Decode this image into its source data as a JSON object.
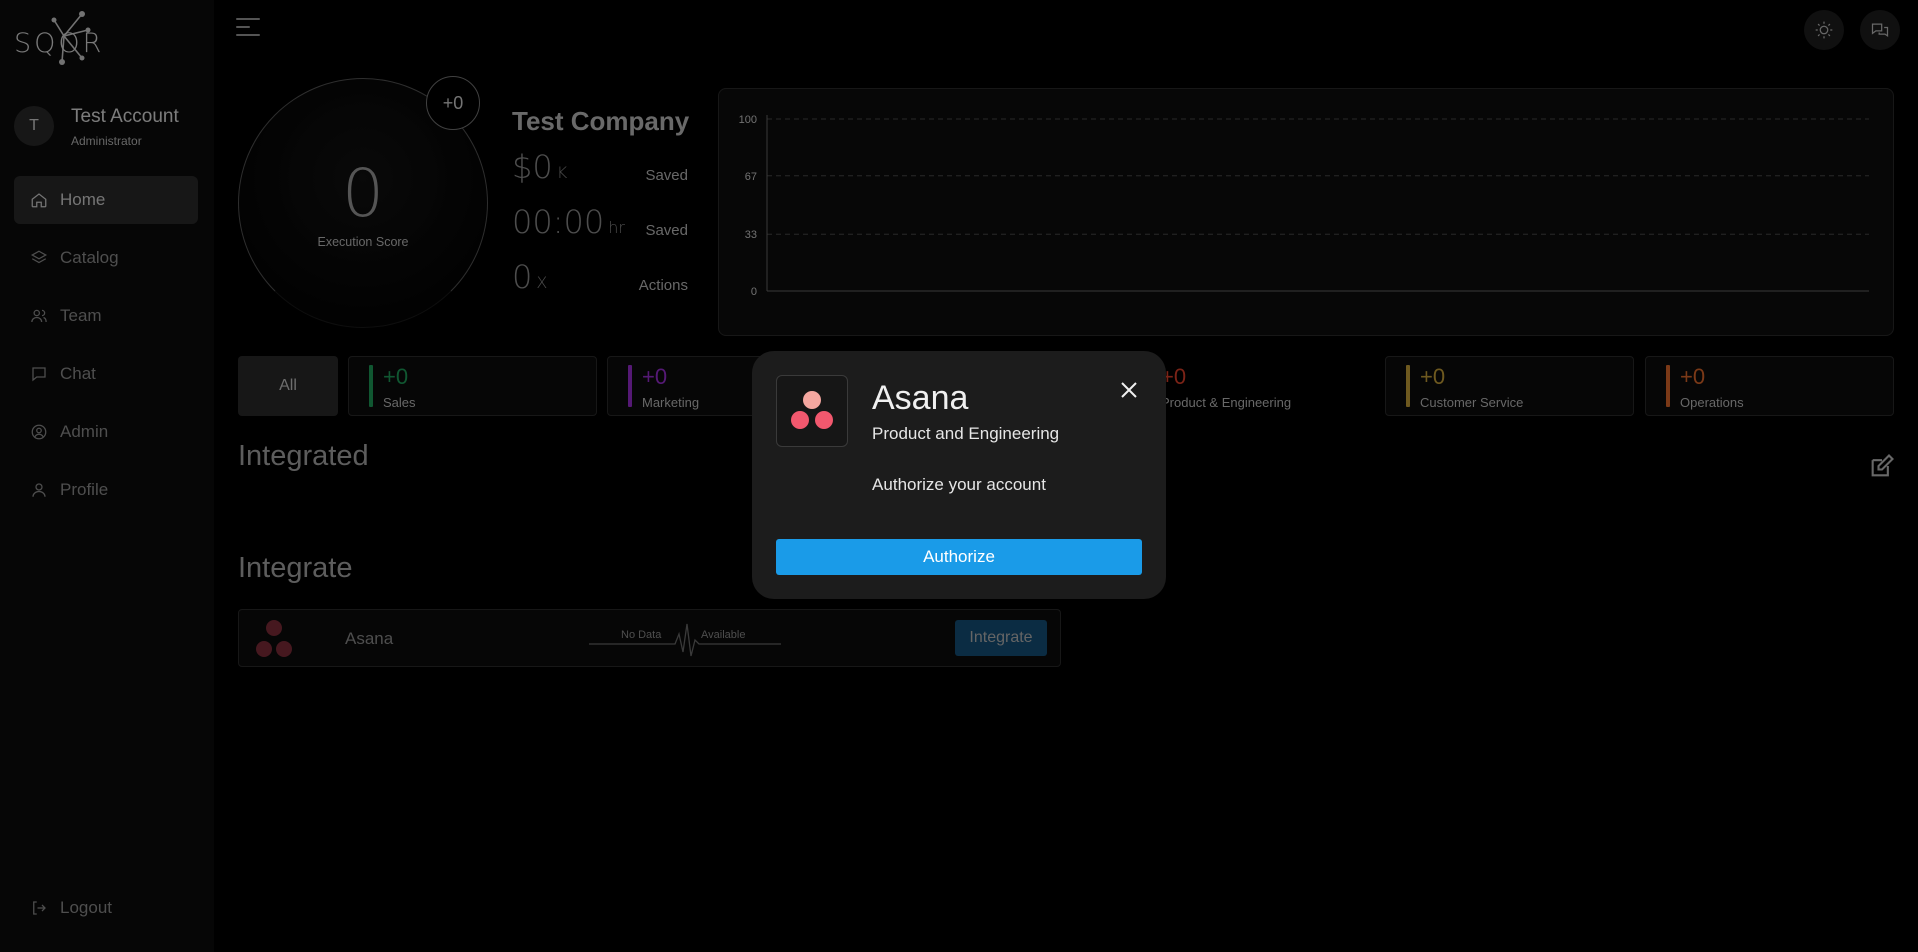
{
  "logo": {
    "text": "SQOR"
  },
  "user": {
    "initial": "T",
    "name": "Test Account",
    "role": "Administrator"
  },
  "nav": {
    "items": [
      {
        "label": "Home",
        "icon": "home-icon",
        "active": true
      },
      {
        "label": "Catalog",
        "icon": "layers-icon",
        "active": false
      },
      {
        "label": "Team",
        "icon": "users-icon",
        "active": false
      },
      {
        "label": "Chat",
        "icon": "chat-icon",
        "active": false
      },
      {
        "label": "Admin",
        "icon": "admin-icon",
        "active": false
      },
      {
        "label": "Profile",
        "icon": "profile-icon",
        "active": false
      }
    ],
    "logout": "Logout"
  },
  "score": {
    "value": "0",
    "label": "Execution Score",
    "delta": "+0"
  },
  "company": {
    "name": "Test Company",
    "metrics": [
      {
        "value": "$0",
        "unit": "K",
        "label": "Saved"
      },
      {
        "value": "00:00",
        "unit": "hr",
        "label": "Saved"
      },
      {
        "value": "0",
        "unit": "X",
        "label": "Actions"
      }
    ]
  },
  "chart_data": {
    "type": "line",
    "ylim": [
      0,
      100
    ],
    "yticks": [
      "100",
      "67",
      "33",
      "0"
    ],
    "grid": true,
    "series": []
  },
  "categories": {
    "all_label": "All",
    "items": [
      {
        "value": "+0",
        "name": "Sales",
        "color": "#1e9e5a"
      },
      {
        "value": "+0",
        "name": "Marketing",
        "color": "#9b2fd6"
      },
      {
        "value": "+0",
        "name": "Product & Engineering",
        "color": "#e0402a"
      },
      {
        "value": "+0",
        "name": "Customer Service",
        "color": "#c9a23a"
      },
      {
        "value": "+0",
        "name": "Operations",
        "color": "#e0682a"
      }
    ]
  },
  "sections": {
    "integrated": "Integrated",
    "integrate": "Integrate"
  },
  "integration": {
    "name": "Asana",
    "no_data": "No Data",
    "available": "Available",
    "button": "Integrate"
  },
  "modal": {
    "title": "Asana",
    "subtitle": "Product and Engineering",
    "message": "Authorize your account",
    "button": "Authorize"
  },
  "colors": {
    "accent": "#1a9be8",
    "asana_top": "#f5a7a0",
    "asana_bottom": "#f2586e"
  }
}
